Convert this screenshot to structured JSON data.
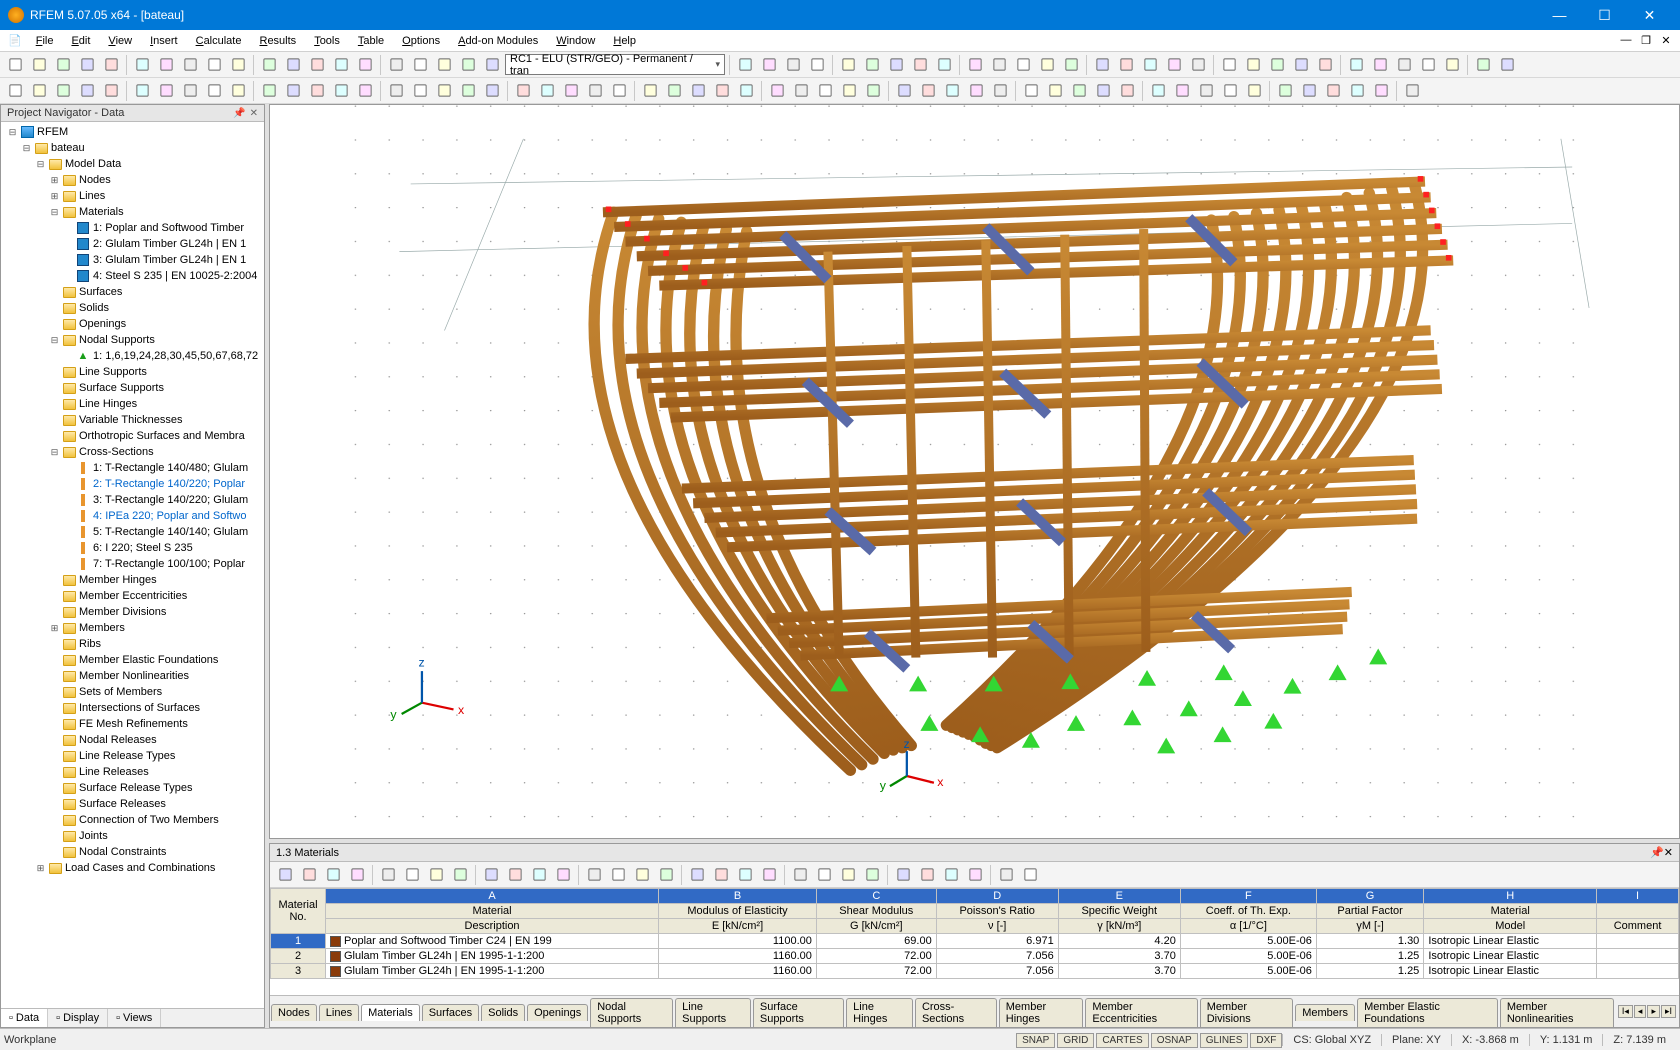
{
  "window": {
    "title": "RFEM 5.07.05 x64 - [bateau]"
  },
  "menu": [
    "File",
    "Edit",
    "View",
    "Insert",
    "Calculate",
    "Results",
    "Tools",
    "Table",
    "Options",
    "Add-on Modules",
    "Window",
    "Help"
  ],
  "loadcase_combo": "RC1 - ELU (STR/GEO) - Permanent / tran",
  "navigator": {
    "title": "Project Navigator - Data",
    "root": "RFEM",
    "project": "bateau",
    "model_data": "Model Data",
    "nodes": "Nodes",
    "lines": "Lines",
    "materials": "Materials",
    "materials_items": [
      "1: Poplar and Softwood Timber",
      "2: Glulam Timber GL24h | EN 1",
      "3: Glulam Timber GL24h | EN 1",
      "4: Steel S 235 | EN 10025-2:2004"
    ],
    "surfaces": "Surfaces",
    "solids": "Solids",
    "openings": "Openings",
    "nodal_supports": "Nodal Supports",
    "nodal_supports_item": "1: 1,6,19,24,28,30,45,50,67,68,72",
    "line_supports": "Line Supports",
    "surface_supports": "Surface Supports",
    "line_hinges": "Line Hinges",
    "var_thick": "Variable Thicknesses",
    "ortho": "Orthotropic Surfaces and Membra",
    "cross_sections": "Cross-Sections",
    "cs_items": [
      {
        "t": "1: T-Rectangle 140/480; Glulam",
        "l": false
      },
      {
        "t": "2: T-Rectangle 140/220; Poplar",
        "l": true
      },
      {
        "t": "3: T-Rectangle 140/220; Glulam",
        "l": false
      },
      {
        "t": "4: IPEa 220; Poplar and Softwo",
        "l": true
      },
      {
        "t": "5: T-Rectangle 140/140; Glulam",
        "l": false
      },
      {
        "t": "6: I 220; Steel S 235",
        "l": false
      },
      {
        "t": "7: T-Rectangle 100/100; Poplar",
        "l": false
      }
    ],
    "rest": [
      "Member Hinges",
      "Member Eccentricities",
      "Member Divisions",
      "Members",
      "Ribs",
      "Member Elastic Foundations",
      "Member Nonlinearities",
      "Sets of Members",
      "Intersections of Surfaces",
      "FE Mesh Refinements",
      "Nodal Releases",
      "Line Release Types",
      "Line Releases",
      "Surface Release Types",
      "Surface Releases",
      "Connection of Two Members",
      "Joints",
      "Nodal Constraints"
    ],
    "load_cases": "Load Cases and Combinations",
    "tabs": [
      "Data",
      "Display",
      "Views"
    ]
  },
  "data_panel": {
    "title": "1.3 Materials",
    "col_letters": [
      "A",
      "B",
      "C",
      "D",
      "E",
      "F",
      "G",
      "H",
      "I"
    ],
    "headers1": [
      "Material",
      "Material",
      "Modulus of Elasticity",
      "Shear Modulus",
      "Poisson's Ratio",
      "Specific Weight",
      "Coeff. of Th. Exp.",
      "Partial Factor",
      "Material",
      ""
    ],
    "headers2": [
      "No.",
      "Description",
      "E [kN/cm²]",
      "G [kN/cm²]",
      "ν [-]",
      "γ [kN/m³]",
      "α [1/°C]",
      "γM [-]",
      "Model",
      "Comment"
    ],
    "rows": [
      {
        "no": "1",
        "sw": "#8a3b0a",
        "desc": "Poplar and Softwood Timber C24 | EN 199",
        "E": "1100.00",
        "G": "69.00",
        "nu": "6.971",
        "gamma": "4.20",
        "alpha": "5.00E-06",
        "pf": "1.30",
        "model": "Isotropic Linear Elastic",
        "comment": ""
      },
      {
        "no": "2",
        "sw": "#8a3b0a",
        "desc": "Glulam Timber GL24h | EN 1995-1-1:200",
        "E": "1160.00",
        "G": "72.00",
        "nu": "7.056",
        "gamma": "3.70",
        "alpha": "5.00E-06",
        "pf": "1.25",
        "model": "Isotropic Linear Elastic",
        "comment": ""
      },
      {
        "no": "3",
        "sw": "#8a3b0a",
        "desc": "Glulam Timber GL24h | EN 1995-1-1:200",
        "E": "1160.00",
        "G": "72.00",
        "nu": "7.056",
        "gamma": "3.70",
        "alpha": "5.00E-06",
        "pf": "1.25",
        "model": "Isotropic Linear Elastic",
        "comment": ""
      }
    ],
    "tabs": [
      "Nodes",
      "Lines",
      "Materials",
      "Surfaces",
      "Solids",
      "Openings",
      "Nodal Supports",
      "Line Supports",
      "Surface Supports",
      "Line Hinges",
      "Cross-Sections",
      "Member Hinges",
      "Member Eccentricities",
      "Member Divisions",
      "Members",
      "Member Elastic Foundations",
      "Member Nonlinearities"
    ]
  },
  "status": {
    "left": "Workplane",
    "chips": [
      "SNAP",
      "GRID",
      "CARTES",
      "OSNAP",
      "GLINES",
      "DXF"
    ],
    "cs": "CS: Global XYZ",
    "plane": "Plane: XY",
    "x": "X:   -3.868 m",
    "y": "Y:   1.131 m",
    "z": "Z:   7.139 m"
  }
}
